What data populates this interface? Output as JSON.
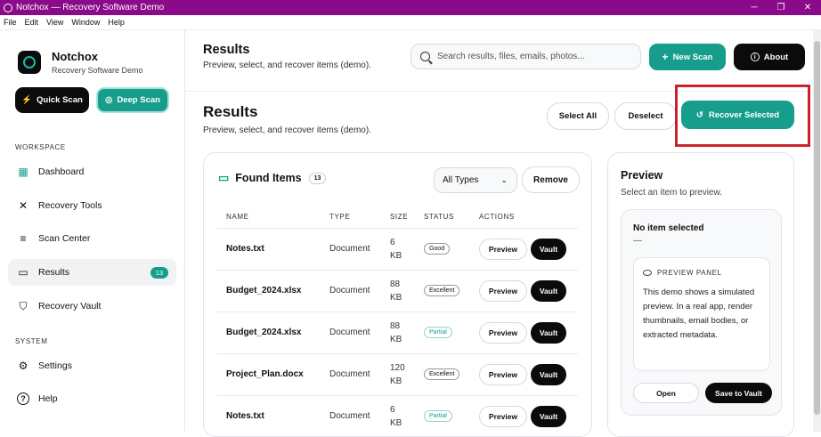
{
  "window": {
    "title": "Notchox — Recovery Software Demo",
    "minimize": "─",
    "maximize": "❐",
    "close": "✕"
  },
  "menu": [
    "File",
    "Edit",
    "View",
    "Window",
    "Help"
  ],
  "brand": {
    "name": "Notchox",
    "subtitle": "Recovery Software Demo"
  },
  "sidebar": {
    "quick_scan": "Quick Scan",
    "deep_scan": "Deep Scan",
    "workspace_label": "WORKSPACE",
    "system_label": "SYSTEM",
    "items": [
      {
        "label": "Dashboard",
        "icon": "grid-icon"
      },
      {
        "label": "Recovery Tools",
        "icon": "tools-icon"
      },
      {
        "label": "Scan Center",
        "icon": "scan-icon"
      },
      {
        "label": "Results",
        "icon": "folder-icon",
        "badge": "13"
      },
      {
        "label": "Recovery Vault",
        "icon": "shield-icon"
      },
      {
        "label": "Settings",
        "icon": "gear-icon"
      },
      {
        "label": "Help",
        "icon": "help-icon"
      }
    ]
  },
  "header": {
    "title": "Results",
    "subtitle": "Preview, select, and recover items (demo).",
    "search_placeholder": "Search results, files, emails, photos...",
    "new_scan": "New Scan",
    "about": "About"
  },
  "section": {
    "title": "Results",
    "subtitle": "Preview, select, and recover items (demo).",
    "select_all": "Select All",
    "deselect": "Deselect",
    "recover_selected": "Recover Selected"
  },
  "found": {
    "title": "Found Items",
    "count": "13",
    "filter": "All Types",
    "remove": "Remove",
    "columns": [
      "NAME",
      "TYPE",
      "SIZE",
      "STATUS",
      "ACTIONS"
    ],
    "preview_label": "Preview",
    "vault_label": "Vault",
    "rows": [
      {
        "name": "Notes.txt",
        "type": "Document",
        "size_num": "6",
        "size_unit": "KB",
        "status": "Good",
        "partial": false
      },
      {
        "name": "Budget_2024.xlsx",
        "type": "Document",
        "size_num": "88",
        "size_unit": "KB",
        "status": "Excellent",
        "partial": false
      },
      {
        "name": "Budget_2024.xlsx",
        "type": "Document",
        "size_num": "88",
        "size_unit": "KB",
        "status": "Partial",
        "partial": true
      },
      {
        "name": "Project_Plan.docx",
        "type": "Document",
        "size_num": "120",
        "size_unit": "KB",
        "status": "Excellent",
        "partial": false
      },
      {
        "name": "Notes.txt",
        "type": "Document",
        "size_num": "6",
        "size_unit": "KB",
        "status": "Partial",
        "partial": true
      }
    ]
  },
  "preview": {
    "title": "Preview",
    "subtitle": "Select an item to preview.",
    "no_item": "No item selected",
    "dash": "—",
    "panel_label": "PREVIEW PANEL",
    "panel_text": "This demo shows a simulated preview. In a real app, render thumbnails, email bodies, or extracted metadata.",
    "open": "Open",
    "save": "Save to Vault"
  },
  "colors": {
    "accent": "#169d8c",
    "titlebar": "#8a0a8a",
    "highlight": "#c8232c"
  }
}
